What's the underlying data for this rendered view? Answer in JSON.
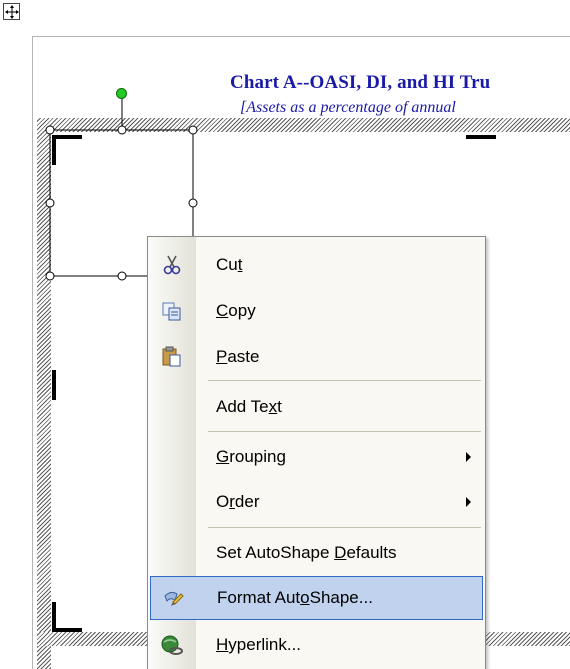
{
  "chart": {
    "title": "Chart A--OASI, DI, and HI Tru",
    "subtitle": "[Assets as a percentage of annual"
  },
  "context_menu": {
    "items": [
      {
        "icon": "scissors-icon",
        "pre": "Cu",
        "accel": "t",
        "post": ""
      },
      {
        "icon": "copy-icon",
        "pre": "",
        "accel": "C",
        "post": "opy"
      },
      {
        "icon": "paste-icon",
        "pre": "",
        "accel": "P",
        "post": "aste"
      },
      {
        "icon": "",
        "pre": "Add Te",
        "accel": "x",
        "post": "t"
      },
      {
        "icon": "",
        "pre": "",
        "accel": "G",
        "post": "rouping"
      },
      {
        "icon": "",
        "pre": "O",
        "accel": "r",
        "post": "der"
      },
      {
        "icon": "",
        "pre": "Set AutoShape ",
        "accel": "D",
        "post": "efaults"
      },
      {
        "icon": "format-autoshape-icon",
        "pre": "Format Aut",
        "accel": "o",
        "post": "Shape..."
      },
      {
        "icon": "hyperlink-icon",
        "pre": "",
        "accel": "H",
        "post": "yperlink..."
      }
    ]
  },
  "colors": {
    "title_text": "#1a1aa8",
    "rotate_handle": "#22cc22",
    "menu_highlight": "#c1d2ee",
    "menu_highlight_border": "#316ac5"
  }
}
